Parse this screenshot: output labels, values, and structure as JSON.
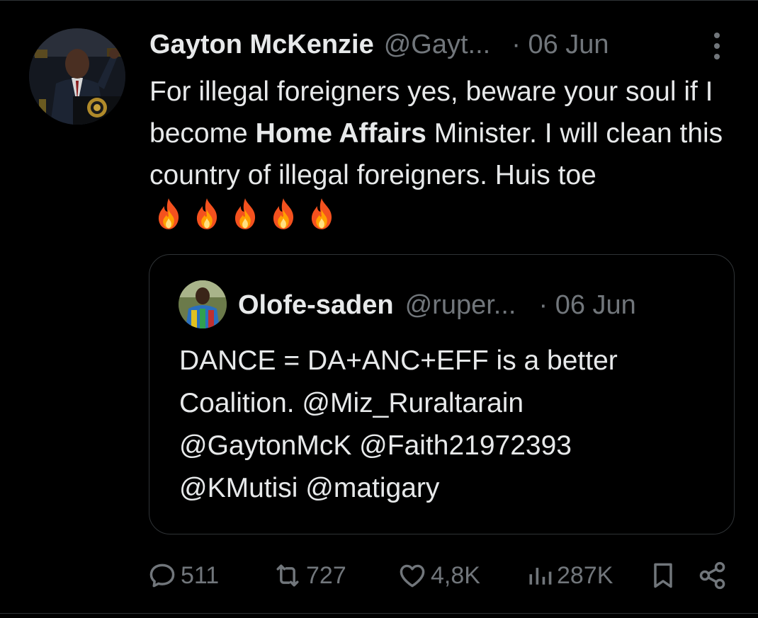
{
  "tweet": {
    "display_name": "Gayton McKenzie",
    "handle": "@Gayt...",
    "date": "· 06 Jun",
    "text_before": "For illegal foreigners yes, beware your soul if I become ",
    "text_bold": "Home Affairs",
    "text_after": " Minister. I will clean this country of illegal foreigners. Huis toe",
    "emoji": "fire-emoji",
    "emoji_count": 5
  },
  "quote": {
    "display_name": "Olofe-saden",
    "handle": "@ruper...",
    "date": "· 06 Jun",
    "text_line1": "DANCE = DA+ANC+EFF is a better",
    "text_line2": "Coalition. @Miz_Ruraltarain",
    "text_line3": "@GaytonMcK @Faith21972393",
    "text_line4": "@KMutisi @matigary"
  },
  "actions": {
    "replies": "511",
    "retweets": "727",
    "likes": "4,8K",
    "views": "287K"
  },
  "icons": {
    "reply": "reply-icon",
    "retweet": "retweet-icon",
    "like": "heart-icon",
    "views": "views-icon",
    "bookmark": "bookmark-icon",
    "share": "share-icon",
    "more": "more-icon"
  },
  "colors": {
    "background": "#000000",
    "text": "#e7e9ea",
    "secondary": "#71767b",
    "border": "#2f3336"
  }
}
